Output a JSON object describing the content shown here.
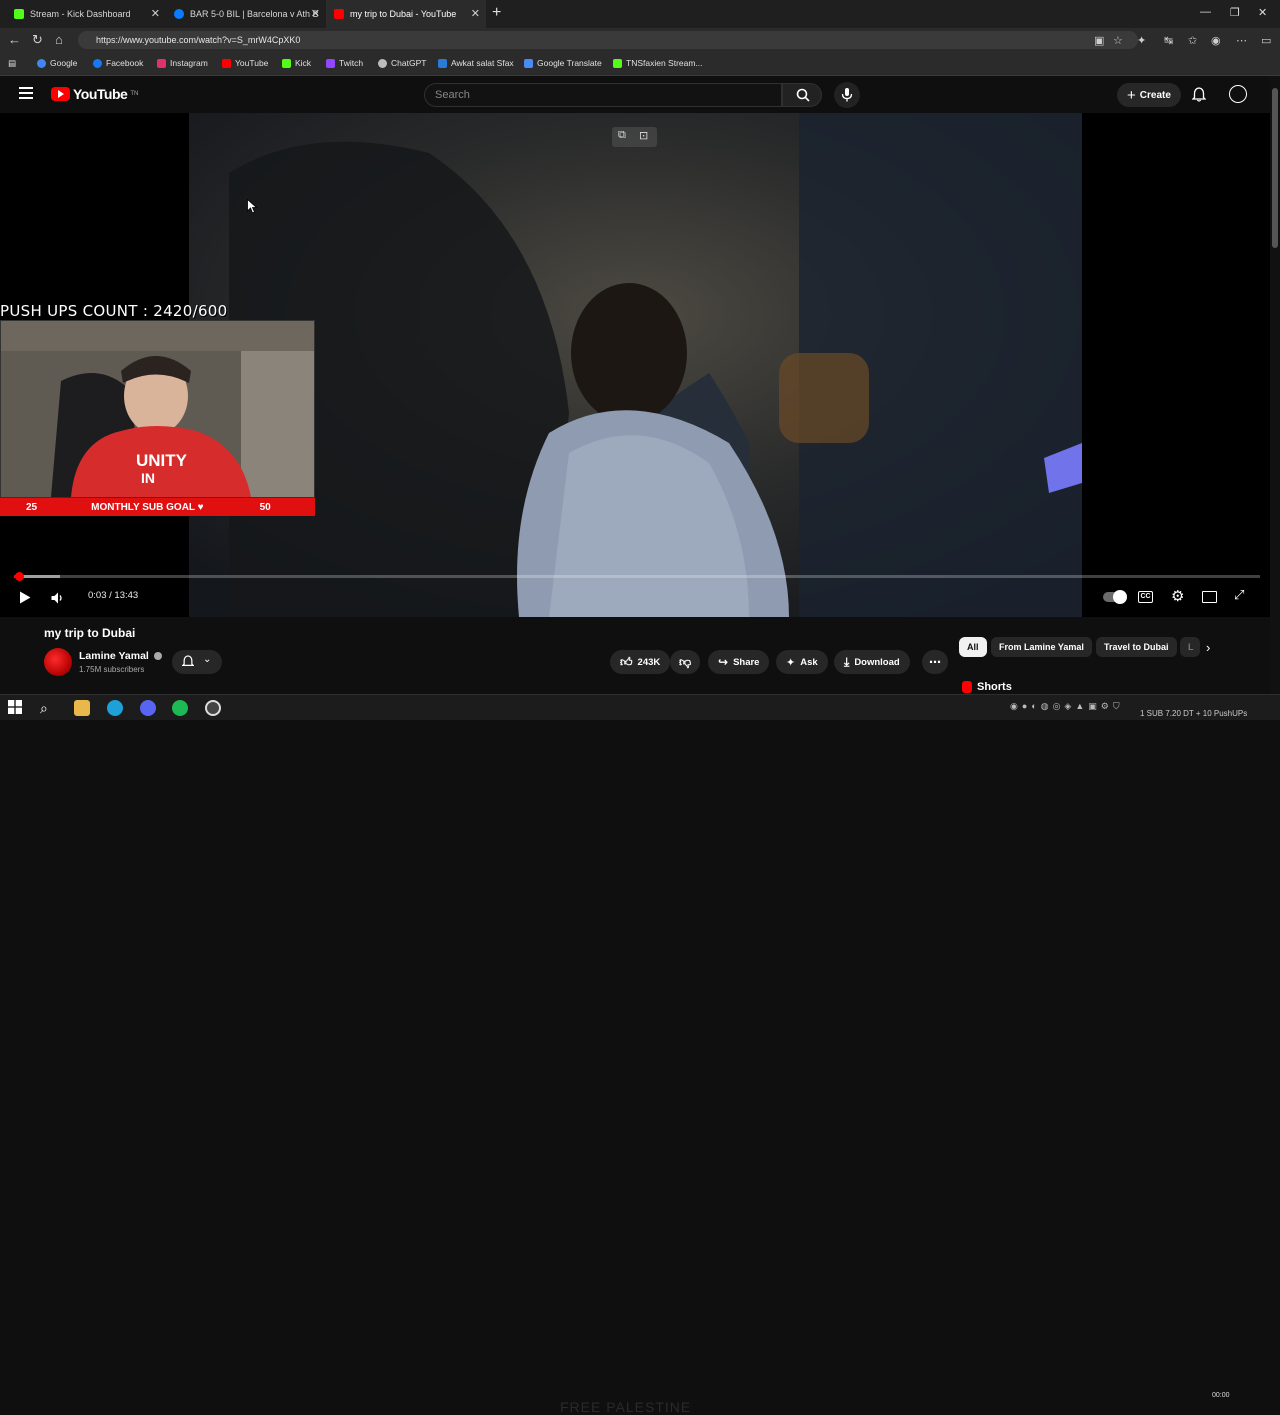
{
  "browser": {
    "tabs": [
      {
        "title": "Stream - Kick Dashboard",
        "color": "#53fc18"
      },
      {
        "title": "BAR 5-0 BIL | Barcelona v Ath Bilbao",
        "color": "#0a7cff"
      },
      {
        "title": "my trip to Dubai - YouTube",
        "color": "#ff0000"
      }
    ],
    "url": "https://www.youtube.com/watch?v=S_mrW4CpXK0",
    "bookmarks": [
      {
        "label": "Google",
        "color": "#4285f4"
      },
      {
        "label": "Facebook",
        "color": "#1877f2"
      },
      {
        "label": "Instagram",
        "color": "#e1306c"
      },
      {
        "label": "YouTube",
        "color": "#ff0000"
      },
      {
        "label": "Kick",
        "color": "#53fc18"
      },
      {
        "label": "Twitch",
        "color": "#9146ff"
      },
      {
        "label": "ChatGPT",
        "color": "#bbbbbb"
      },
      {
        "label": "Awkat salat Sfax",
        "color": "#2a7ad8"
      },
      {
        "label": "Google Translate",
        "color": "#4a8af4"
      },
      {
        "label": "TNSfaxien Stream...",
        "color": "#53fc18"
      }
    ]
  },
  "youtube": {
    "logo_text": "YouTube",
    "logo_suffix": "TN",
    "search_placeholder": "Search",
    "create_label": "Create"
  },
  "overlay": {
    "pushups_label": "PUSH UPS COUNT : 2420/600",
    "sub_goal_left": "25",
    "sub_goal_label": "MONTHLY SUB GOAL ♥",
    "sub_goal_right": "50"
  },
  "player": {
    "time_current": "0:03",
    "time_separator": " / ",
    "time_total": "13:43",
    "progress": 0.004
  },
  "video": {
    "title": "my trip to Dubai",
    "channel": "Lamine Yamal",
    "subscribers": "1.75M subscribers",
    "likes": "243K",
    "share_label": "Share",
    "ask_label": "Ask",
    "download_label": "Download"
  },
  "chips": [
    "All",
    "From Lamine Yamal",
    "Travel to Dubai"
  ],
  "shorts_label": "Shorts",
  "taskbar": {
    "watermark": "FREE PALESTINE",
    "clock_time": "00:00",
    "clock_date": "1 SUB 7.20 DT + 10 PushUPs"
  },
  "colors": {
    "accent": "#ff0000",
    "kick": "#53fc18"
  }
}
